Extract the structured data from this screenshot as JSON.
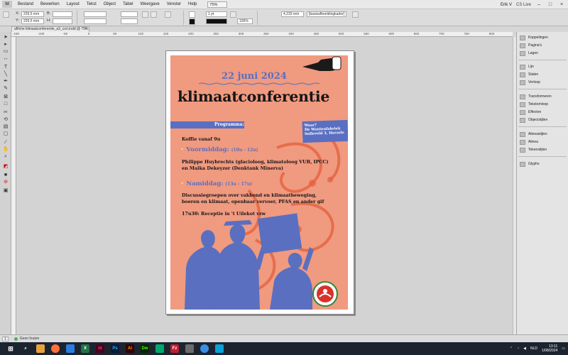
{
  "menubar": {
    "app_short": "Id",
    "items": [
      "Bestand",
      "Bewerken",
      "Layout",
      "Tekst",
      "Object",
      "Tabel",
      "Weergave",
      "Venster",
      "Help"
    ],
    "zoom": "75%",
    "user": "Erik V",
    "cs_live": "CS Live"
  },
  "controlbar": {
    "x_label": "X:",
    "x_value": "229,5 mm",
    "y_label": "Y:",
    "y_value": "229,5 mm",
    "w_label": "B:",
    "h_label": "H:",
    "stroke_weight": "1 pt",
    "opacity": "100%",
    "size_value": "4,233 mm",
    "frame_style": "[basisafbeeldingkader]"
  },
  "document": {
    "tab_label": "affiche klimaatconferentie_a3_cori.indd @ 75%"
  },
  "ruler": {
    "numbers": [
      "-150",
      "-100",
      "-50",
      "0",
      "50",
      "100",
      "150",
      "200",
      "250",
      "300",
      "350",
      "400",
      "450",
      "500",
      "550",
      "600",
      "650",
      "700",
      "750",
      "800"
    ]
  },
  "poster": {
    "date": "22 juni 2024",
    "title": "klimaatconferentie",
    "programma_label": "Programma:",
    "where_label": "Waar?",
    "where_line1": "De Wantenfabriek",
    "where_line2": "Solleveld 3, Herzele",
    "koffie": "Koffie vanaf 9u",
    "voormiddag": "Voormiddag:",
    "voormiddag_time": "(10u - 12u)",
    "speakers_line1": "Philippe Huybrechts (glacioloog, klimatoloog VUB, IPCC)",
    "speakers_line2": "en Maika Dekeyzer (Denktank Minerva)",
    "namiddag": "Namiddag:",
    "namiddag_time": "(13u - 17u)",
    "discussie_line1": "Discussiegroepen over vakbond en klimaatbeweging,",
    "discussie_line2": "boeren en klimaat, openbaar vervoer, PFAS en ander gif",
    "receptie": "17u30: Receptie in 't Uilekot vzw",
    "bullet": "•"
  },
  "panel": {
    "groups": [
      [
        "Koppelingen",
        "Pagina's",
        "Lagen"
      ],
      [
        "Lijn",
        "Stalen",
        "Verloop"
      ],
      [
        "Transformeren",
        "Tekstomloop",
        "Effecten",
        "Objectstijlen"
      ],
      [
        "Alineastijlen",
        "Alinea",
        "Tekenstijlen"
      ],
      [
        "Glyphs"
      ]
    ]
  },
  "statusbar": {
    "page": "1",
    "state": "Geen fouten"
  },
  "taskbar": {
    "time": "13:11",
    "date": "1/08/2024",
    "lang": "NLD"
  },
  "colors": {
    "poster_bg": "#f09a80",
    "accent_blue": "#5a6fc0",
    "dark_text": "#161616"
  }
}
